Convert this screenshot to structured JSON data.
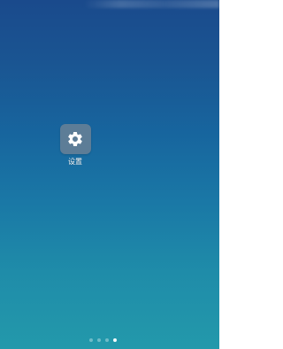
{
  "home_screen": {
    "apps": [
      {
        "label": "设置",
        "icon": "gear-icon"
      }
    ],
    "page_indicator": {
      "total_pages": 4,
      "current_page": 4
    }
  }
}
